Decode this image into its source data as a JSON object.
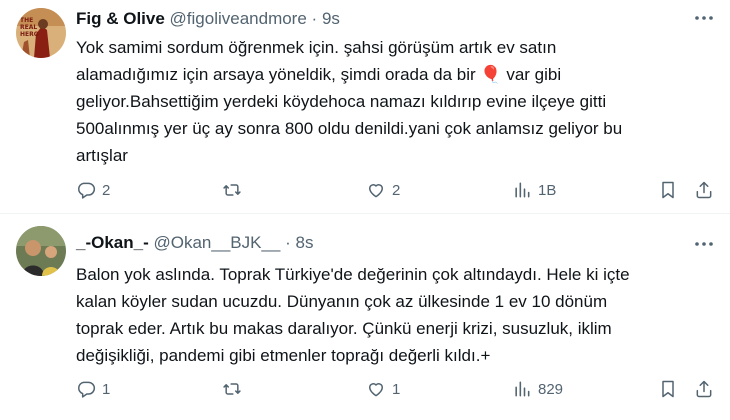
{
  "tweets": [
    {
      "display_name": "Fig & Olive",
      "handle": "@figoliveandmore",
      "separator": "·",
      "time": "9s",
      "body_lines": [
        "Yok samimi sordum öğrenmek için. şahsi görüşüm artık ev satın",
        "alamadığımız için arsaya yöneldik, şimdi orada da bir",
        "var gibi",
        "geliyor.Bahsettiğim yerdeki köydehoca namazı kıldırıp evine ilçeye gitti",
        "500alınmış yer üç ay sonra 800 oldu denildi.yani çok anlamsız geliyor bu",
        "artışlar"
      ],
      "emoji": "🎈",
      "avatar_text": [
        "THE",
        "REAL",
        "HERO"
      ],
      "replies": "2",
      "retweets": "",
      "likes": "2",
      "views": "1B"
    },
    {
      "display_name": "_-Okan_-",
      "handle": "@Okan__BJK__",
      "separator": "·",
      "time": "8s",
      "body_lines": [
        "Balon yok aslında. Toprak Türkiye'de değerinin çok altındaydı. Hele ki içte",
        "kalan köyler sudan ucuzdu. Dünyanın çok az ülkesinde 1 ev 10 dönüm",
        "toprak eder. Artık bu makas daralıyor. Çünkü enerji krizi, susuzluk, iklim",
        "değişikliği, pandemi gibi etmenler toprağı değerli kıldı.+"
      ],
      "replies": "1",
      "retweets": "",
      "likes": "1",
      "views": "829"
    }
  ],
  "icons": {
    "reply": "speech-bubble",
    "retweet": "retweet-arrows",
    "like": "heart",
    "views": "bar-chart",
    "bookmark": "bookmark",
    "share": "share-upload",
    "more": "three-dots"
  },
  "colors": {
    "text": "#0f1419",
    "secondary": "#536471",
    "divider": "#eff3f4",
    "balloon": "#e0245e"
  }
}
